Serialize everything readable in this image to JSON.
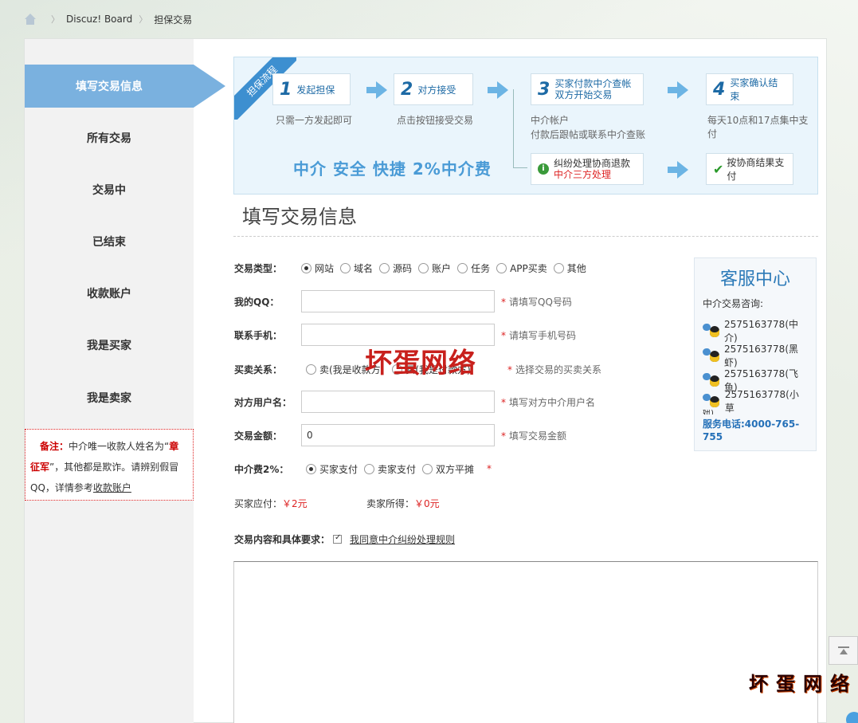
{
  "breadcrumb": {
    "site": "Discuz! Board",
    "current": "担保交易"
  },
  "sidebar": {
    "items": [
      {
        "label": "填写交易信息",
        "active": true
      },
      {
        "label": "所有交易"
      },
      {
        "label": "交易中"
      },
      {
        "label": "已结束"
      },
      {
        "label": "收款账户"
      },
      {
        "label": "我是买家"
      },
      {
        "label": "我是卖家"
      }
    ],
    "note": {
      "prefix": "备注：",
      "text1": "中介唯一收款人姓名为“",
      "name": "章征军",
      "text2": "”，其他都是欺诈。请辨别假冒QQ，详情参考",
      "link": "收款账户"
    }
  },
  "flow": {
    "ribbon": "担保流程",
    "steps": [
      {
        "num": "1",
        "label": "发起担保",
        "sub": "只需一方发起即可"
      },
      {
        "num": "2",
        "label": "对方接受",
        "sub": "点击按钮接受交易"
      },
      {
        "num": "3",
        "label_line1": "买家付款中介查帐",
        "label_line2": "双方开始交易",
        "sub_line1": "中介帐户",
        "sub_line2": "付款后跟帖或联系中介查账"
      },
      {
        "num": "4",
        "label": "买家确认结束",
        "sub": "每天10点和17点集中支付"
      }
    ],
    "dispute_line1": "纠纷处理协商退款",
    "dispute_line2": "中介三方处理",
    "settle": "按协商结果支付",
    "slogan": "中介  安全 快捷  2%中介费"
  },
  "form": {
    "title": "填写交易信息",
    "type_label": "交易类型：",
    "types": [
      "网站",
      "域名",
      "源码",
      "账户",
      "任务",
      "APP买卖",
      "其他"
    ],
    "qq_label": "我的QQ：",
    "qq_hint": "请填写QQ号码",
    "phone_label": "联系手机：",
    "phone_hint": "请填写手机号码",
    "relation_label": "买卖关系：",
    "relation_option": "卖(我是收款方)",
    "relation_option2": "买(我是付款方)",
    "relation_hint": "选择交易的买卖关系",
    "user_label": "对方用户名：",
    "user_hint": "填写对方中介用户名",
    "amount_label": "交易金额：",
    "amount_value": "0",
    "amount_hint": "填写交易金额",
    "fee_label": "中介费2%：",
    "fee_options": [
      "买家支付",
      "卖家支付",
      "双方平摊"
    ],
    "buyer_pay_label": "买家应付：",
    "buyer_pay_value": "￥2元",
    "seller_get_label": "卖家所得：",
    "seller_get_value": "￥0元",
    "content_label": "交易内容和具体要求：",
    "agree_text": "我同意中介纠纷处理规则",
    "star": "*"
  },
  "support": {
    "title": "客服中心",
    "subtitle": "中介交易咨询:",
    "contacts": [
      "2575163778(中介)",
      "2575163778(黑虾)",
      "2575163778(飞鱼)",
      "2575163778(小草"
    ],
    "overflow_text": "妞)",
    "tel": "服务电话:4000-765-755"
  },
  "watermarks": {
    "center": "坏蛋网络",
    "corner": "坏蛋网络"
  },
  "colors": {
    "accent": "#7ab1df",
    "link_blue": "#2470b8",
    "warning_red": "#d22222"
  }
}
